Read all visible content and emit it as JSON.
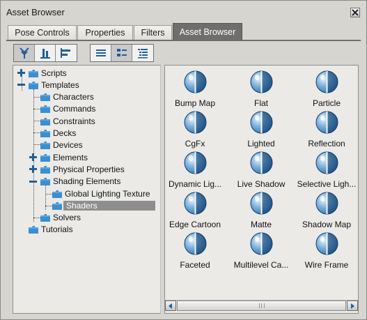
{
  "window": {
    "title": "Asset Browser"
  },
  "tabs": [
    {
      "label": "Pose Controls",
      "active": false
    },
    {
      "label": "Properties",
      "active": false
    },
    {
      "label": "Filters",
      "active": false
    },
    {
      "label": "Asset Browser",
      "active": true
    }
  ],
  "toolbar": {
    "group1": [
      "tree-view-icon",
      "bottom-align-icon",
      "left-align-icon"
    ],
    "group2": [
      "list-view-icon",
      "thumbnail-view-icon",
      "detail-list-icon"
    ]
  },
  "tree": {
    "items": [
      {
        "label": "Scripts",
        "expander": "plus"
      },
      {
        "label": "Templates",
        "expander": "minus"
      },
      {
        "label": "Characters"
      },
      {
        "label": "Commands"
      },
      {
        "label": "Constraints"
      },
      {
        "label": "Decks"
      },
      {
        "label": "Devices"
      },
      {
        "label": "Elements",
        "expander": "plus"
      },
      {
        "label": "Physical Properties",
        "expander": "plus"
      },
      {
        "label": "Shading Elements",
        "expander": "minus"
      },
      {
        "label": "Global Lighting Texture"
      },
      {
        "label": "Shaders",
        "selected": true
      },
      {
        "label": "Solvers"
      },
      {
        "label": "Tutorials"
      }
    ]
  },
  "assets": [
    {
      "label": "Bump Map"
    },
    {
      "label": "Flat"
    },
    {
      "label": "Particle"
    },
    {
      "label": "CgFx"
    },
    {
      "label": "Lighted"
    },
    {
      "label": "Reflection"
    },
    {
      "label": "Dynamic Lig..."
    },
    {
      "label": "Live Shadow"
    },
    {
      "label": "Selective Ligh..."
    },
    {
      "label": "Edge Cartoon"
    },
    {
      "label": "Matte"
    },
    {
      "label": "Shadow Map"
    },
    {
      "label": "Faceted"
    },
    {
      "label": "Multilevel Ca..."
    },
    {
      "label": "Wire Frame"
    }
  ],
  "colors": {
    "accent": "#6e6e6e",
    "folder": "#3a8fd0",
    "shader_ball": "#2d6fb0"
  }
}
